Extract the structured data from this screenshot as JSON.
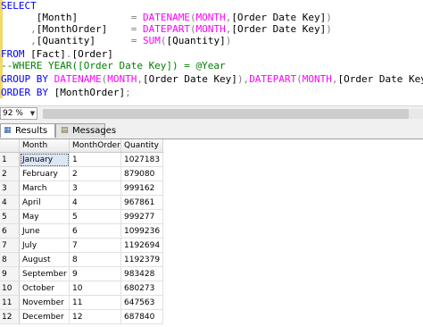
{
  "editor": {
    "lines": [
      [
        {
          "c": "kw",
          "t": "SELECT"
        }
      ],
      [
        {
          "c": "tx",
          "t": "      [Month]         "
        },
        {
          "c": "op",
          "t": "= "
        },
        {
          "c": "fn",
          "t": "DATENAME"
        },
        {
          "c": "op",
          "t": "("
        },
        {
          "c": "fn",
          "t": "MONTH"
        },
        {
          "c": "op",
          "t": ","
        },
        {
          "c": "tx",
          "t": "[Order Date Key]"
        },
        {
          "c": "op",
          "t": ")"
        }
      ],
      [
        {
          "c": "tx",
          "t": "     "
        },
        {
          "c": "op",
          "t": ","
        },
        {
          "c": "tx",
          "t": "[MonthOrder]    "
        },
        {
          "c": "op",
          "t": "= "
        },
        {
          "c": "fn",
          "t": "DATEPART"
        },
        {
          "c": "op",
          "t": "("
        },
        {
          "c": "fn",
          "t": "MONTH"
        },
        {
          "c": "op",
          "t": ","
        },
        {
          "c": "tx",
          "t": "[Order Date Key]"
        },
        {
          "c": "op",
          "t": ")"
        }
      ],
      [
        {
          "c": "tx",
          "t": "     "
        },
        {
          "c": "op",
          "t": ","
        },
        {
          "c": "tx",
          "t": "[Quantity]      "
        },
        {
          "c": "op",
          "t": "= "
        },
        {
          "c": "fn",
          "t": "SUM"
        },
        {
          "c": "op",
          "t": "("
        },
        {
          "c": "tx",
          "t": "[Quantity]"
        },
        {
          "c": "op",
          "t": ")"
        }
      ],
      [
        {
          "c": "kw",
          "t": "FROM "
        },
        {
          "c": "tx",
          "t": "[Fact]"
        },
        {
          "c": "op",
          "t": "."
        },
        {
          "c": "tx",
          "t": "[Order]"
        }
      ],
      [
        {
          "c": "cm",
          "t": "--WHERE YEAR([Order Date Key]) = @Year"
        }
      ],
      [
        {
          "c": "kw",
          "t": "GROUP BY "
        },
        {
          "c": "fn",
          "t": "DATENAME"
        },
        {
          "c": "op",
          "t": "("
        },
        {
          "c": "fn",
          "t": "MONTH"
        },
        {
          "c": "op",
          "t": ","
        },
        {
          "c": "tx",
          "t": "[Order Date Key]"
        },
        {
          "c": "op",
          "t": "),"
        },
        {
          "c": "fn",
          "t": "DATEPART"
        },
        {
          "c": "op",
          "t": "("
        },
        {
          "c": "fn",
          "t": "MONTH"
        },
        {
          "c": "op",
          "t": ","
        },
        {
          "c": "tx",
          "t": "[Order Date Key]"
        },
        {
          "c": "op",
          "t": ")"
        }
      ],
      [
        {
          "c": "kw",
          "t": "ORDER BY "
        },
        {
          "c": "tx",
          "t": "[MonthOrder]"
        },
        {
          "c": "op",
          "t": ";"
        }
      ]
    ]
  },
  "zoom": {
    "value": "92 %",
    "caret_icon": "dropdown-caret-icon"
  },
  "tabs": {
    "results_label": "Results",
    "results_icon": "grid-icon",
    "messages_label": "Messages",
    "messages_icon": "message-icon"
  },
  "grid": {
    "columns": [
      "Month",
      "MonthOrder",
      "Quantity"
    ],
    "rows": [
      {
        "n": "1",
        "month": "January",
        "order": "1",
        "qty": "1027183"
      },
      {
        "n": "2",
        "month": "February",
        "order": "2",
        "qty": "879080"
      },
      {
        "n": "3",
        "month": "March",
        "order": "3",
        "qty": "999162"
      },
      {
        "n": "4",
        "month": "April",
        "order": "4",
        "qty": "967861"
      },
      {
        "n": "5",
        "month": "May",
        "order": "5",
        "qty": "999277"
      },
      {
        "n": "6",
        "month": "June",
        "order": "6",
        "qty": "1099236"
      },
      {
        "n": "7",
        "month": "July",
        "order": "7",
        "qty": "1192694"
      },
      {
        "n": "8",
        "month": "August",
        "order": "8",
        "qty": "1192379"
      },
      {
        "n": "9",
        "month": "September",
        "order": "9",
        "qty": "983428"
      },
      {
        "n": "10",
        "month": "October",
        "order": "10",
        "qty": "680273"
      },
      {
        "n": "11",
        "month": "November",
        "order": "11",
        "qty": "647563"
      },
      {
        "n": "12",
        "month": "December",
        "order": "12",
        "qty": "687840"
      }
    ]
  }
}
